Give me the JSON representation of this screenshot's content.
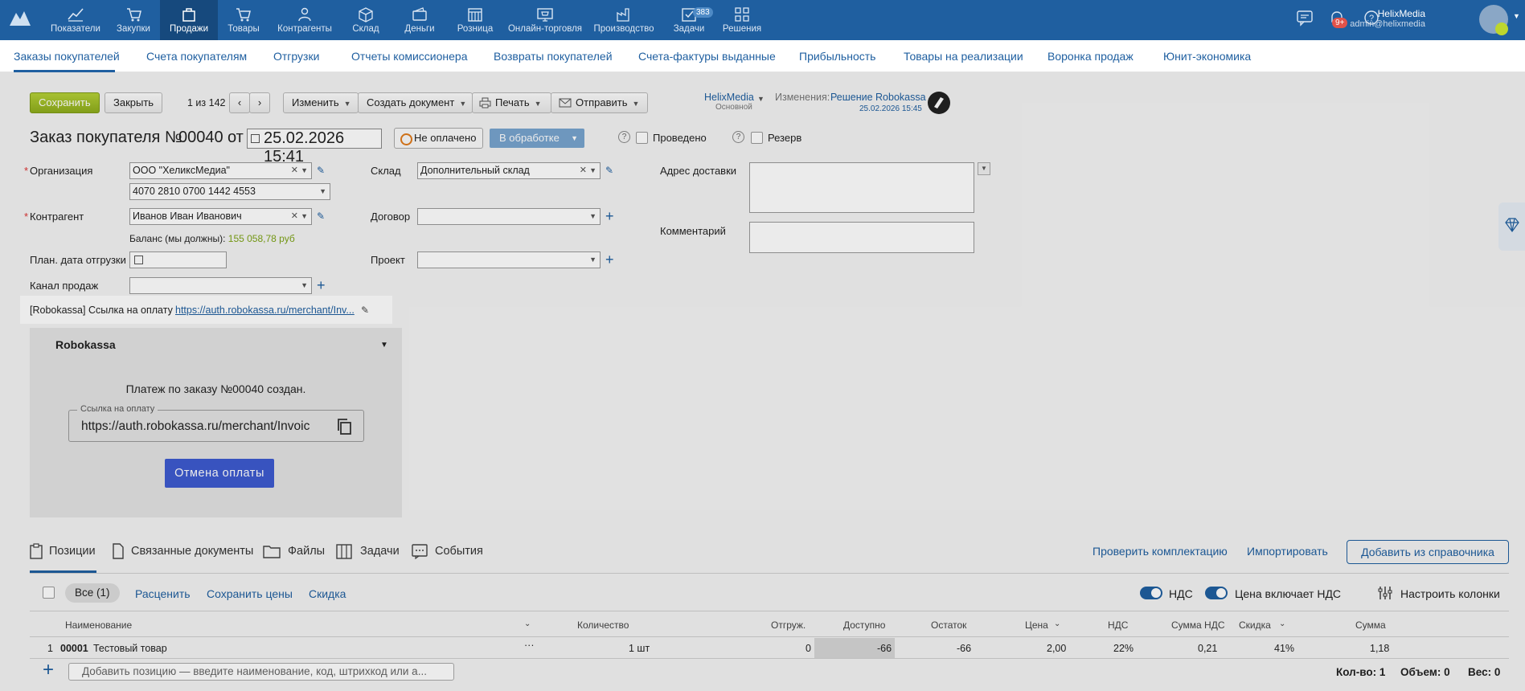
{
  "nav": {
    "items": [
      {
        "label": "Показатели",
        "icon": "chart-line-icon"
      },
      {
        "label": "Закупки",
        "icon": "cart-arrow-icon"
      },
      {
        "label": "Продажи",
        "icon": "bag-icon"
      },
      {
        "label": "Товары",
        "icon": "cart-icon"
      },
      {
        "label": "Контрагенты",
        "icon": "users-icon"
      },
      {
        "label": "Склад",
        "icon": "box-icon"
      },
      {
        "label": "Деньги",
        "icon": "wallet-icon"
      },
      {
        "label": "Розница",
        "icon": "shop-icon"
      },
      {
        "label": "Онлайн-торговля",
        "icon": "online-shop-icon"
      },
      {
        "label": "Производство",
        "icon": "factory-icon"
      },
      {
        "label": "Задачи",
        "icon": "tasks-icon",
        "badge": "383"
      },
      {
        "label": "Решения",
        "icon": "apps-icon"
      }
    ],
    "notifications_badge": "9+",
    "user_name": "HelixMedia",
    "user_email": "admin@helixmedia"
  },
  "subnav": {
    "tabs": [
      "Заказы покупателей",
      "Счета покупателям",
      "Отгрузки",
      "Отчеты комиссионера",
      "Возвраты покупателей",
      "Счета-фактуры выданные",
      "Прибыльность",
      "Товары на реализации",
      "Воронка продаж",
      "Юнит-экономика"
    ]
  },
  "toolbar": {
    "save": "Сохранить",
    "close": "Закрыть",
    "counter": "1 из 142",
    "change": "Изменить",
    "create_doc": "Создать документ",
    "print": "Печать",
    "send": "Отправить",
    "company": "HelixMedia",
    "company_sub": "Основной",
    "changes_label": "Изменения:",
    "changes_value": "Решение Robokassa",
    "changes_date": "25.02.2026 15:45"
  },
  "order": {
    "title": "Заказ покупателя №",
    "number": "00040",
    "from": "от",
    "date": "25.02.2026 15:41",
    "paid_status": "Не оплачено",
    "status": "В обработке",
    "posted": "Проведено",
    "reserve": "Резерв"
  },
  "form": {
    "org_label": "Организация",
    "org_value": "ООО \"ХеликсМедиа\"",
    "account_value": "4070 2810 0700 1442 4553",
    "contractor_label": "Контрагент",
    "contractor_value": "Иванов Иван Иванович",
    "balance_label": "Баланс (мы должны):",
    "balance_value": "155 058,78 руб",
    "ship_date_label": "План. дата отгрузки",
    "channel_label": "Канал продаж",
    "warehouse_label": "Склад",
    "warehouse_value": "Дополнительный склад",
    "contract_label": "Договор",
    "project_label": "Проект",
    "delivery_label": "Адрес доставки",
    "comment_label": "Комментарий"
  },
  "robokassa": {
    "link_label": "[Robokassa] Ссылка на оплату",
    "link_url": "https://auth.robokassa.ru/merchant/Inv...",
    "widget_title": "Robokassa",
    "message": "Платеж по заказу №00040 создан.",
    "field_legend": "Ссылка на оплату",
    "field_value": "https://auth.robokassa.ru/merchant/Invoic",
    "cancel": "Отмена оплаты"
  },
  "positions": {
    "tabs": [
      "Позиции",
      "Связанные документы",
      "Файлы",
      "Задачи",
      "События"
    ],
    "check_set": "Проверить комплектацию",
    "import": "Импортировать",
    "add_from_catalog": "Добавить из справочника",
    "all": "Все (1)",
    "reprice": "Расценить",
    "save_prices": "Сохранить цены",
    "discount": "Скидка",
    "vat_toggle": "НДС",
    "price_incl_vat": "Цена включает НДС",
    "configure_columns": "Настроить колонки",
    "columns": [
      "Наименование",
      "Количество",
      "Отгруж.",
      "Доступно",
      "Остаток",
      "Цена",
      "НДС",
      "Сумма НДС",
      "Скидка",
      "Сумма"
    ],
    "rows": [
      {
        "n": "1",
        "code": "00001",
        "name": "Тестовый товар",
        "qty": "1 шт",
        "shipped": "0",
        "available": "-66",
        "stock": "-66",
        "price": "2,00",
        "vat": "22%",
        "vat_sum": "0,21",
        "discount": "41%",
        "sum": "1,18"
      }
    ],
    "add_placeholder": "Добавить позицию — введите наименование, код, штрихкод или а...",
    "total_qty": "Кол-во: 1",
    "total_volume": "Объем: 0",
    "total_weight": "Вес: 0"
  },
  "colors": {
    "topbar": "#1f5fa0",
    "save": "#9bbb25",
    "link": "#1f5fa0",
    "cancel": "#3d5bd0"
  }
}
